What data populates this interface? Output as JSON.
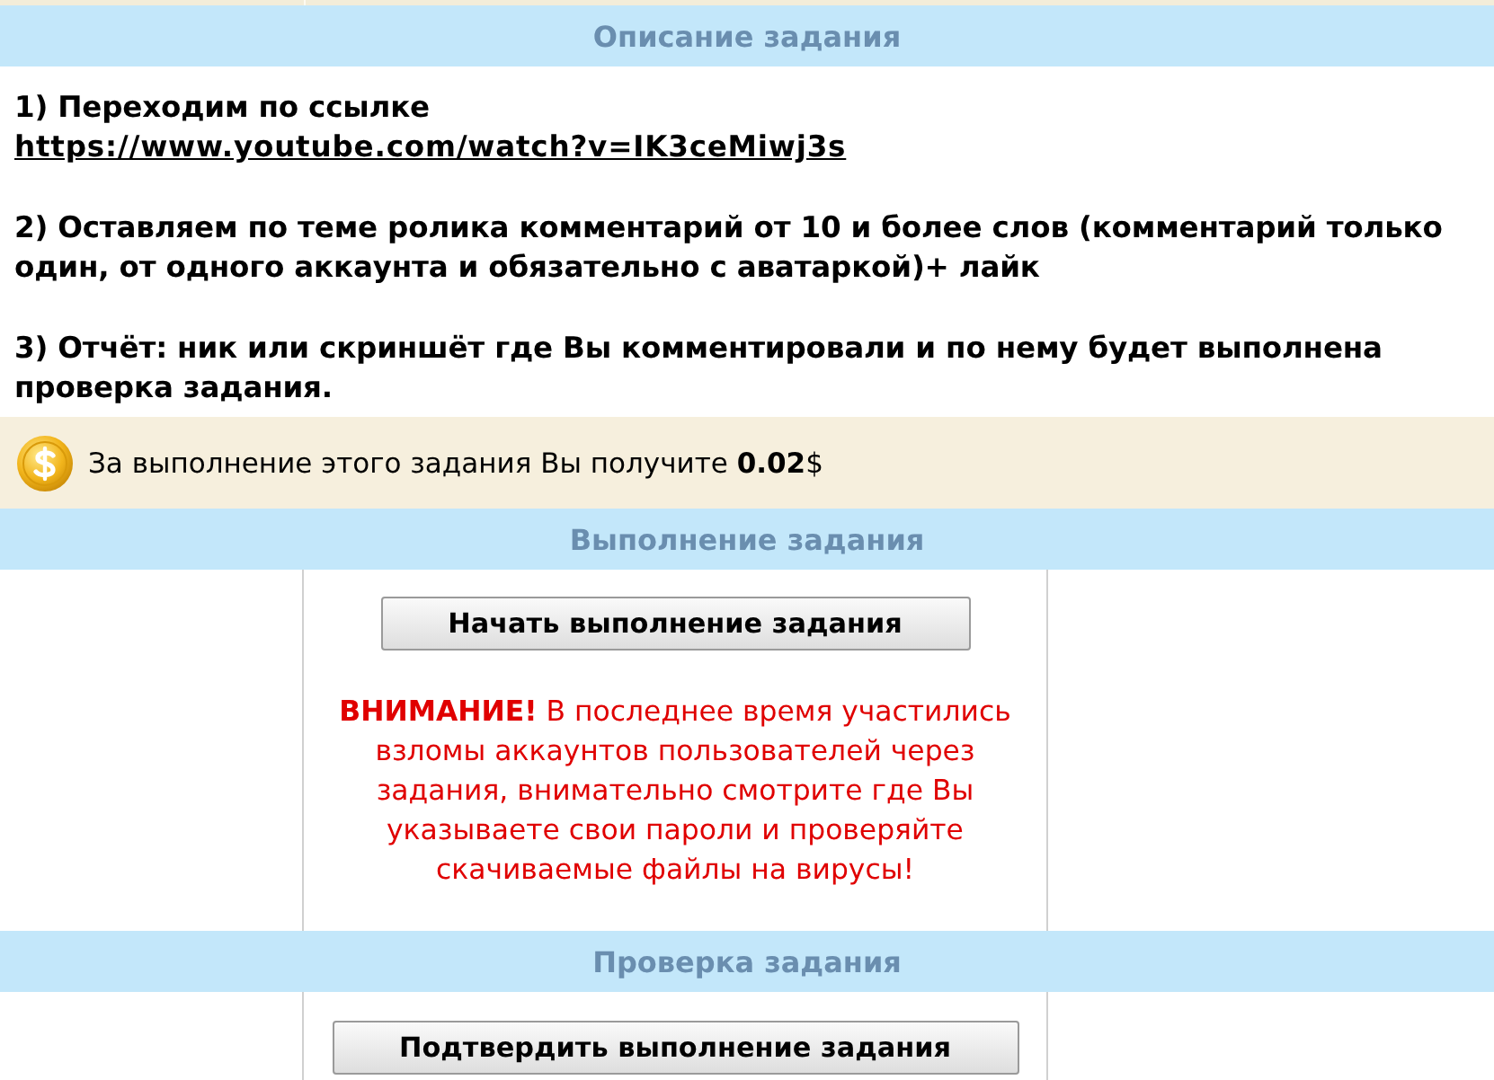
{
  "description": {
    "title": "Описание задания",
    "steps": [
      {
        "text": "1) Переходим по ссылке",
        "link": "https://www.youtube.com/watch?v=IK3ceMiwj3s"
      },
      {
        "text": "2) Оставляем по теме ролика комментарий от 10 и более слов (комментарий только один, от одного аккаунта и обязательно с аватаркой)+ лайк"
      },
      {
        "text": "3) Отчёт: ник или скриншёт где Вы комментировали и по нему будет выполнена проверка задания."
      }
    ],
    "reward": "За выполнение этого задания Вы получите **0.02**$"
  },
  "execution": {
    "title": "Выполнение задания",
    "button": "Начать выполнение задания",
    "warning": "**ВНИМАНИЕ!** В последнее время участились взломы аккаунтов пользователей через задания, внимательно смотрите где Вы указываете свои пароли и проверяйте скачиваемые файлы на вирусы!"
  },
  "verification": {
    "title": "Проверка задания",
    "button": "Подтвердить выполнение задания"
  }
}
